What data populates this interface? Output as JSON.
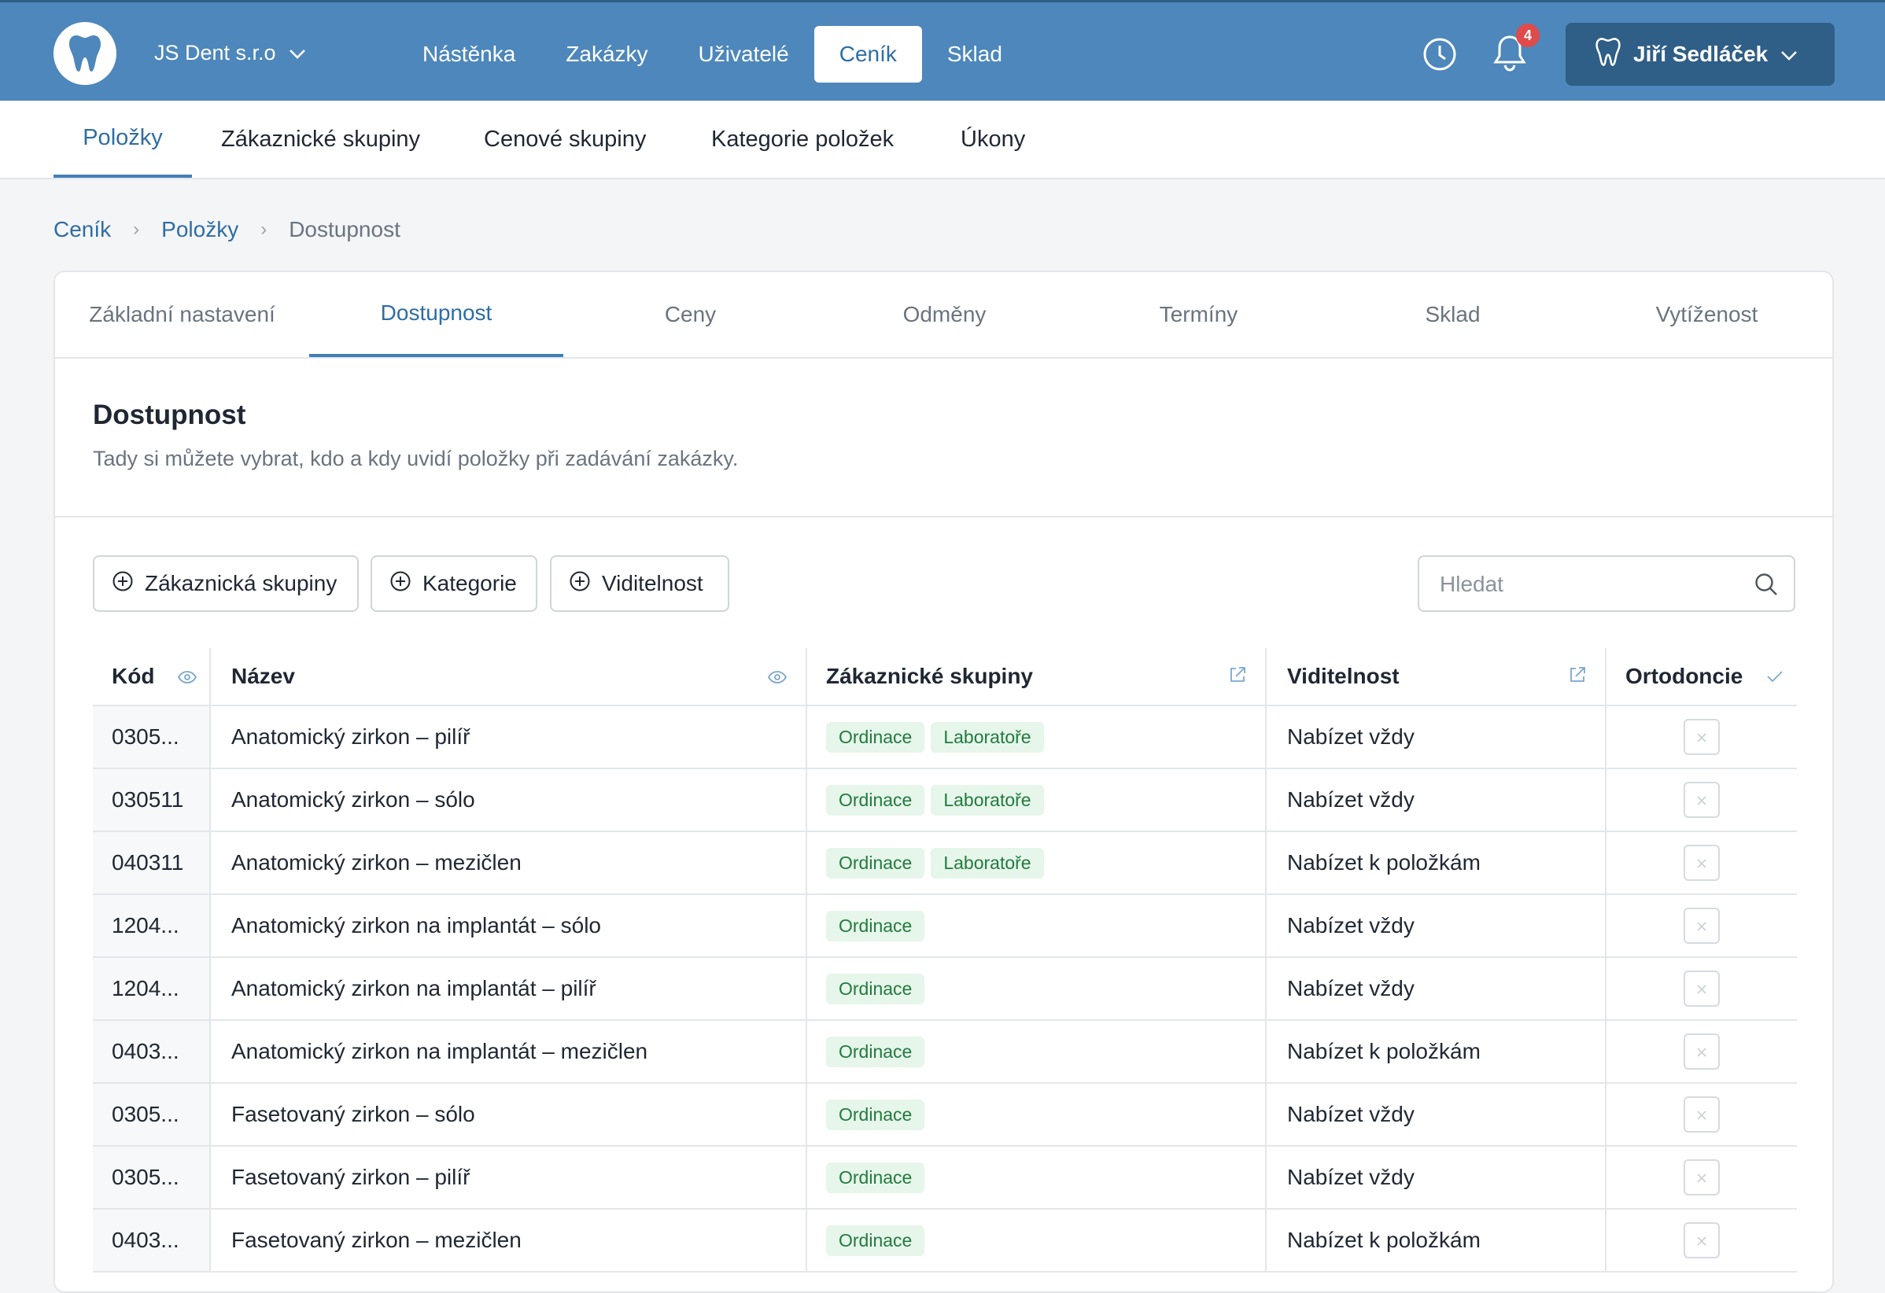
{
  "header": {
    "company": "JS Dent s.r.o",
    "nav": [
      "Nástěnka",
      "Zakázky",
      "Uživatelé",
      "Ceník",
      "Sklad"
    ],
    "active_nav": "Ceník",
    "notifications_count": "4",
    "user_name": "Jiří Sedláček",
    "accent": "#4d87bb"
  },
  "subnav": [
    "Položky",
    "Zákaznické skupiny",
    "Cenové skupiny",
    "Kategorie položek",
    "Úkony"
  ],
  "breadcrumb": {
    "root": "Ceník",
    "parent": "Položky",
    "current": "Dostupnost"
  },
  "tabs": [
    "Základní nastavení",
    "Dostupnost",
    "Ceny",
    "Odměny",
    "Termíny",
    "Sklad",
    "Vytíženost"
  ],
  "section": {
    "title": "Dostupnost",
    "description": "Tady si můžete vybrat, kdo a kdy uvidí položky při zadávání zakázky."
  },
  "filters": {
    "customer_group": "Zákaznická skupiny",
    "category": "Kategorie",
    "visibility": "Viditelnost",
    "search_placeholder": "Hledat"
  },
  "table": {
    "columns": [
      "Kód",
      "Název",
      "Zákaznické skupiny",
      "Viditelnost",
      "Ortodoncie"
    ],
    "rows": [
      {
        "code": "0305...",
        "name": "Anatomický zirkon – pilíř",
        "groups": [
          "Ordinace",
          "Laboratoře"
        ],
        "visibility": "Nabízet vždy"
      },
      {
        "code": "030511",
        "name": "Anatomický zirkon – sólo",
        "groups": [
          "Ordinace",
          "Laboratoře"
        ],
        "visibility": "Nabízet vždy"
      },
      {
        "code": "040311",
        "name": "Anatomický zirkon – mezičlen",
        "groups": [
          "Ordinace",
          "Laboratoře"
        ],
        "visibility": "Nabízet k položkám"
      },
      {
        "code": "1204...",
        "name": "Anatomický zirkon na implantát – sólo",
        "groups": [
          "Ordinace"
        ],
        "visibility": "Nabízet vždy"
      },
      {
        "code": "1204...",
        "name": "Anatomický zirkon na implantát – pilíř",
        "groups": [
          "Ordinace"
        ],
        "visibility": "Nabízet vždy"
      },
      {
        "code": "0403...",
        "name": "Anatomický zirkon na implantát – mezičlen",
        "groups": [
          "Ordinace"
        ],
        "visibility": "Nabízet k položkám"
      },
      {
        "code": "0305...",
        "name": "Fasetovaný zirkon – sólo",
        "groups": [
          "Ordinace"
        ],
        "visibility": "Nabízet vždy"
      },
      {
        "code": "0305...",
        "name": "Fasetovaný zirkon – pilíř",
        "groups": [
          "Ordinace"
        ],
        "visibility": "Nabízet vždy"
      },
      {
        "code": "0403...",
        "name": "Fasetovaný zirkon – mezičlen",
        "groups": [
          "Ordinace"
        ],
        "visibility": "Nabízet k položkám"
      }
    ]
  }
}
